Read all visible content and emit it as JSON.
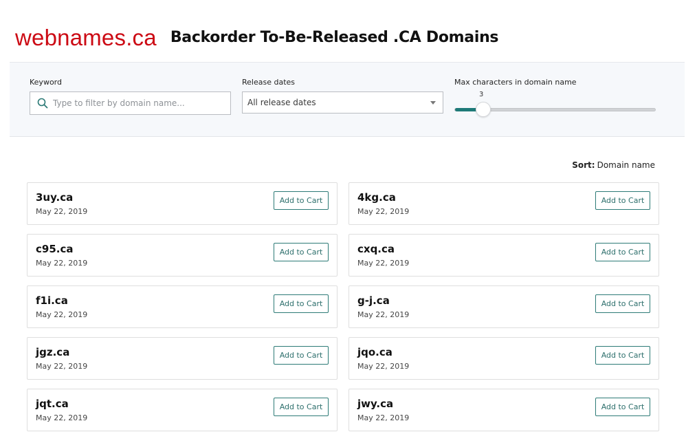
{
  "header": {
    "logo_light": "web",
    "logo_bold": "names.ca",
    "title": "Backorder To-Be-Released .CA Domains"
  },
  "filters": {
    "keyword": {
      "label": "Keyword",
      "placeholder": "Type to filter by domain name...",
      "value": "",
      "icon": "search-icon"
    },
    "release_dates": {
      "label": "Release dates",
      "selected": "All release dates",
      "icon": "chevron-down-icon"
    },
    "max_chars": {
      "label": "Max characters in domain name",
      "value": "3",
      "fraction": 0.14
    }
  },
  "sort": {
    "label": "Sort:",
    "value": "Domain name"
  },
  "colors": {
    "brand": "#cc0a14",
    "accent": "#1e7a78"
  },
  "results": [
    {
      "domain": "3uy.ca",
      "date": "May 22, 2019",
      "button": "Add to Cart"
    },
    {
      "domain": "4kg.ca",
      "date": "May 22, 2019",
      "button": "Add to Cart"
    },
    {
      "domain": "c95.ca",
      "date": "May 22, 2019",
      "button": "Add to Cart"
    },
    {
      "domain": "cxq.ca",
      "date": "May 22, 2019",
      "button": "Add to Cart"
    },
    {
      "domain": "f1i.ca",
      "date": "May 22, 2019",
      "button": "Add to Cart"
    },
    {
      "domain": "g-j.ca",
      "date": "May 22, 2019",
      "button": "Add to Cart"
    },
    {
      "domain": "jgz.ca",
      "date": "May 22, 2019",
      "button": "Add to Cart"
    },
    {
      "domain": "jqo.ca",
      "date": "May 22, 2019",
      "button": "Add to Cart"
    },
    {
      "domain": "jqt.ca",
      "date": "May 22, 2019",
      "button": "Add to Cart"
    },
    {
      "domain": "jwy.ca",
      "date": "May 22, 2019",
      "button": "Add to Cart"
    }
  ]
}
